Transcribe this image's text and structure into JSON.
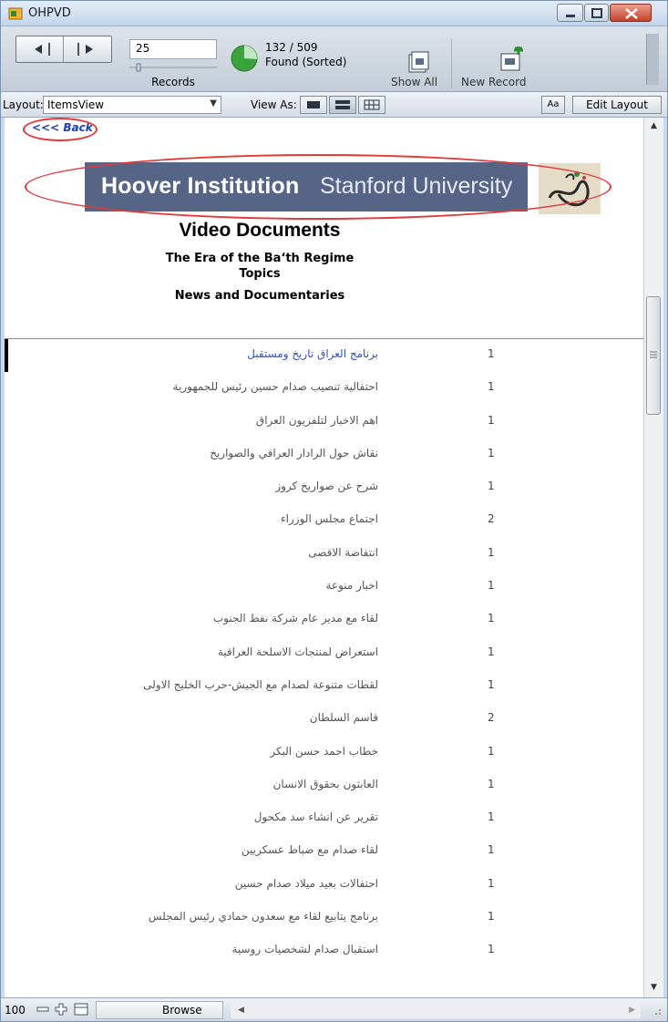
{
  "window": {
    "title": "OHPVD"
  },
  "toolbar": {
    "current_record": "25",
    "records_label": "Records",
    "found_count": "132 / 509",
    "found_status": "Found (Sorted)",
    "found_fraction": 0.26,
    "show_all_label": "Show All",
    "new_record_label": "New Record"
  },
  "layoutbar": {
    "layout_label": "Layout:",
    "layout_value": "ItemsView",
    "view_as_label": "View As:",
    "text_format_label": "Aa",
    "edit_layout_label": "Edit Layout"
  },
  "content": {
    "back_label": "<<< Back",
    "banner_name": "Hoover Institution",
    "banner_university": "Stanford University",
    "heading": "Video Documents",
    "subheading": "The Era of the Ba‘th Regime",
    "topics_label": "Topics",
    "category": "News and Documentaries"
  },
  "items": [
    {
      "title": "برنامج العراق تاريخ ومستقبل",
      "count": "1",
      "selected": true
    },
    {
      "title": "احتفالية تنصيب صدام حسين رئيس للجمهورية",
      "count": "1"
    },
    {
      "title": "اهم الاخبار لتلفزيون العراق",
      "count": "1"
    },
    {
      "title": "نقاش حول الرادار العراقي والصواريخ",
      "count": "1"
    },
    {
      "title": "شرح عن صواريخ كروز",
      "count": "1"
    },
    {
      "title": "اجتماع مجلس الوزراء",
      "count": "2"
    },
    {
      "title": "انتفاضة الاقصى",
      "count": "1"
    },
    {
      "title": "اخبار منوعة",
      "count": "1"
    },
    {
      "title": "لقاء مع مدير عام شركة نفط الجنوب",
      "count": "1"
    },
    {
      "title": "استعراض لمنتجات الاسلحة العراقية",
      "count": "1"
    },
    {
      "title": "لقطات متنوعة لصدام مع الجيش-حرب الخليج الاولى",
      "count": "1"
    },
    {
      "title": "قاسم السلطان",
      "count": "2"
    },
    {
      "title": "خطاب احمد حسن البكر",
      "count": "1"
    },
    {
      "title": "العابثون بحقوق الانسان",
      "count": "1"
    },
    {
      "title": "تقرير عن انشاء سد مكحول",
      "count": "1"
    },
    {
      "title": "لقاء صدام مع ضباط عسكريين",
      "count": "1"
    },
    {
      "title": "احتفالات بعيد ميلاد صدام حسين",
      "count": "1"
    },
    {
      "title": "برنامج يتابيع لقاء مع سعدون حمادي رئيس المجلس",
      "count": "1"
    },
    {
      "title": "استقبال صدام لشخصيات روسية",
      "count": "1"
    }
  ],
  "statusbar": {
    "zoom": "100",
    "mode": "Browse"
  },
  "colors": {
    "banner": "#566486",
    "link": "#2b52c4",
    "highlight_ring": "#e23a3a"
  },
  "icons": [
    "app-icon",
    "prev-record-icon",
    "next-record-icon",
    "found-pie-icon",
    "show-all-icon",
    "new-record-icon",
    "form-view-icon",
    "list-view-icon",
    "table-view-icon",
    "zoom-out-icon",
    "zoom-in-icon",
    "toolbar-toggle-icon",
    "resize-grip-icon",
    "logo"
  ]
}
